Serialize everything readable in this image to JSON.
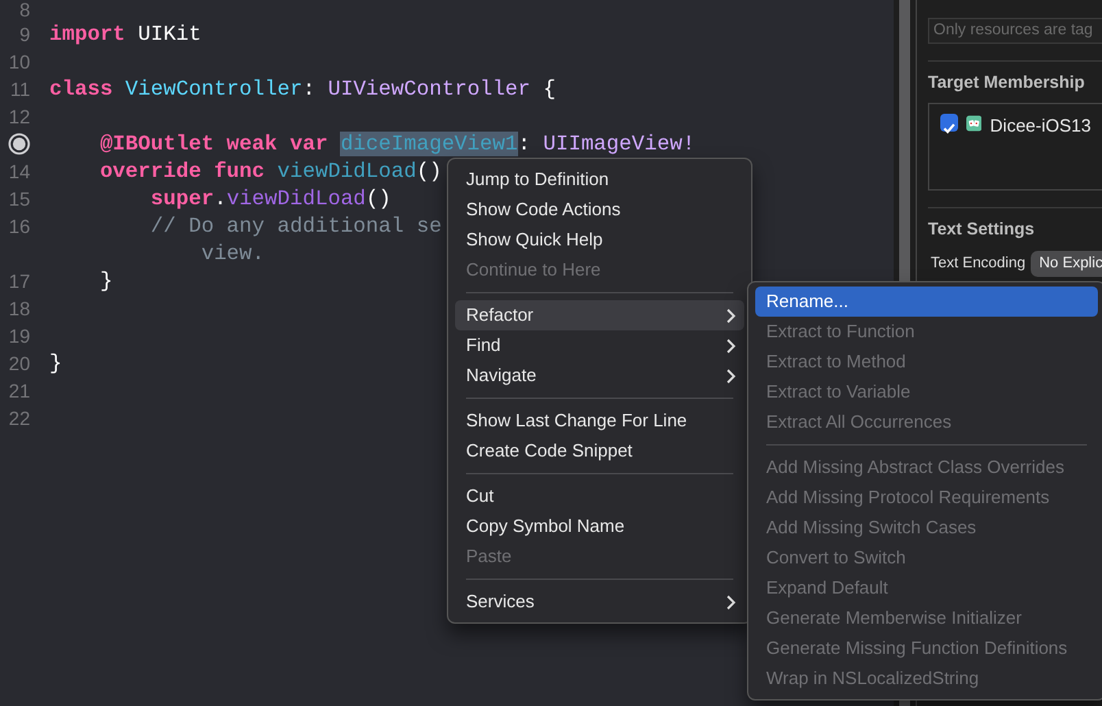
{
  "editor": {
    "lines": [
      {
        "number": "8",
        "breakpoint": false
      },
      {
        "number": "9",
        "breakpoint": false,
        "tokens": [
          {
            "kind": "keyword",
            "text": "import"
          },
          {
            "kind": "plain",
            "text": " UIKit"
          }
        ]
      },
      {
        "number": "10",
        "breakpoint": false
      },
      {
        "number": "11",
        "breakpoint": false,
        "tokens": [
          {
            "kind": "keyword",
            "text": "class"
          },
          {
            "kind": "declared_type",
            "text": " ViewController"
          },
          {
            "kind": "plain",
            "text": ": "
          },
          {
            "kind": "type",
            "text": "UIViewController"
          },
          {
            "kind": "plain",
            "text": " {"
          }
        ]
      },
      {
        "number": "12",
        "breakpoint": false
      },
      {
        "breakpoint": true,
        "tokens": [
          {
            "kind": "keyword",
            "text": "    @IBOutlet weak var "
          },
          {
            "kind": "declared_name",
            "text": "diceImageView1",
            "selected": true
          },
          {
            "kind": "plain",
            "text": ": "
          },
          {
            "kind": "type",
            "text": "UIImageView!"
          }
        ]
      },
      {
        "number": "14",
        "breakpoint": false,
        "tokens": [
          {
            "kind": "keyword",
            "text": "    override func "
          },
          {
            "kind": "declared_name",
            "text": "viewDidLoad"
          },
          {
            "kind": "plain",
            "text": "()"
          }
        ]
      },
      {
        "number": "15",
        "breakpoint": false,
        "tokens": [
          {
            "kind": "keyword",
            "text": "        super"
          },
          {
            "kind": "plain",
            "text": "."
          },
          {
            "kind": "method",
            "text": "viewDidLoad"
          },
          {
            "kind": "plain",
            "text": "()"
          }
        ]
      },
      {
        "number": "16",
        "breakpoint": false,
        "tokens": [
          {
            "kind": "comment",
            "text": "        // Do any additional se"
          }
        ]
      },
      {
        "tokens": [
          {
            "kind": "comment",
            "text": "            view."
          }
        ]
      },
      {
        "number": "17",
        "breakpoint": false,
        "tokens": [
          {
            "kind": "plain",
            "text": "    }"
          }
        ]
      },
      {
        "number": "18",
        "breakpoint": false
      },
      {
        "number": "19",
        "breakpoint": false
      },
      {
        "number": "20",
        "breakpoint": false,
        "tokens": [
          {
            "kind": "plain",
            "text": "}"
          }
        ]
      },
      {
        "number": "21",
        "breakpoint": false
      },
      {
        "number": "22",
        "breakpoint": false
      }
    ]
  },
  "inspector": {
    "search": {
      "placeholder": "Only resources are tag"
    },
    "target_membership": {
      "title": "Target Membership",
      "targets": [
        {
          "name": "Dicee-iOS13",
          "checked": true
        }
      ]
    },
    "text_settings": {
      "title": "Text Settings",
      "rows": [
        {
          "label": "Text Encoding",
          "value": "No Explic"
        }
      ]
    }
  },
  "context_menu": {
    "items": [
      {
        "kind": "item",
        "label": "Jump to Definition",
        "disabled": false,
        "selected": false,
        "submenu": false
      },
      {
        "kind": "item",
        "label": "Show Code Actions",
        "disabled": false,
        "selected": false,
        "submenu": false
      },
      {
        "kind": "item",
        "label": "Show Quick Help",
        "disabled": false,
        "selected": false,
        "submenu": false
      },
      {
        "kind": "item",
        "label": "Continue to Here",
        "disabled": true,
        "selected": false,
        "submenu": false
      },
      {
        "kind": "separator"
      },
      {
        "kind": "item",
        "label": "Refactor",
        "disabled": false,
        "selected": true,
        "submenu": true
      },
      {
        "kind": "item",
        "label": "Find",
        "disabled": false,
        "selected": false,
        "submenu": true
      },
      {
        "kind": "item",
        "label": "Navigate",
        "disabled": false,
        "selected": false,
        "submenu": true
      },
      {
        "kind": "separator"
      },
      {
        "kind": "item",
        "label": "Show Last Change For Line",
        "disabled": false,
        "selected": false,
        "submenu": false
      },
      {
        "kind": "item",
        "label": "Create Code Snippet",
        "disabled": false,
        "selected": false,
        "submenu": false
      },
      {
        "kind": "separator"
      },
      {
        "kind": "item",
        "label": "Cut",
        "disabled": false,
        "selected": false,
        "submenu": false
      },
      {
        "kind": "item",
        "label": "Copy Symbol Name",
        "disabled": false,
        "selected": false,
        "submenu": false
      },
      {
        "kind": "item",
        "label": "Paste",
        "disabled": true,
        "selected": false,
        "submenu": false
      },
      {
        "kind": "separator"
      },
      {
        "kind": "item",
        "label": "Services",
        "disabled": false,
        "selected": false,
        "submenu": true
      }
    ]
  },
  "submenu": {
    "items": [
      {
        "kind": "item",
        "label": "Rename...",
        "disabled": false,
        "selected": true
      },
      {
        "kind": "item",
        "label": "Extract to Function",
        "disabled": true,
        "selected": false
      },
      {
        "kind": "item",
        "label": "Extract to Method",
        "disabled": true,
        "selected": false
      },
      {
        "kind": "item",
        "label": "Extract to Variable",
        "disabled": true,
        "selected": false
      },
      {
        "kind": "item",
        "label": "Extract All Occurrences",
        "disabled": true,
        "selected": false
      },
      {
        "kind": "separator"
      },
      {
        "kind": "item",
        "label": "Add Missing Abstract Class Overrides",
        "disabled": true,
        "selected": false
      },
      {
        "kind": "item",
        "label": "Add Missing Protocol Requirements",
        "disabled": true,
        "selected": false
      },
      {
        "kind": "item",
        "label": "Add Missing Switch Cases",
        "disabled": true,
        "selected": false
      },
      {
        "kind": "item",
        "label": "Convert to Switch",
        "disabled": true,
        "selected": false
      },
      {
        "kind": "item",
        "label": "Expand Default",
        "disabled": true,
        "selected": false
      },
      {
        "kind": "item",
        "label": "Generate Memberwise Initializer",
        "disabled": true,
        "selected": false
      },
      {
        "kind": "item",
        "label": "Generate Missing Function Definitions",
        "disabled": true,
        "selected": false
      },
      {
        "kind": "item",
        "label": "Wrap in NSLocalizedString",
        "disabled": true,
        "selected": false
      }
    ]
  }
}
